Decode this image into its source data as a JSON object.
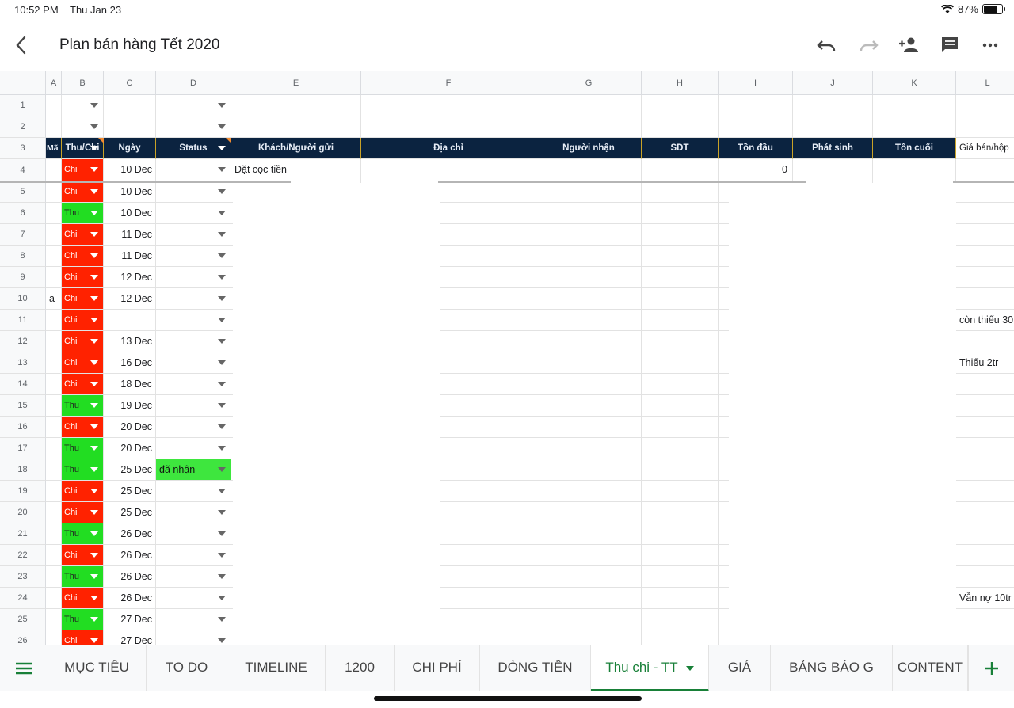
{
  "status_bar": {
    "time": "10:52 PM",
    "date": "Thu Jan 23",
    "battery": "87%",
    "battery_level": 0.87
  },
  "document": {
    "title": "Plan bán hàng Tết 2020"
  },
  "columns": [
    "A",
    "B",
    "C",
    "D",
    "E",
    "F",
    "G",
    "H",
    "I",
    "J",
    "K",
    "L"
  ],
  "header_row": {
    "row_number": "3",
    "a": "Mã",
    "b": "Thu/Chi",
    "c": "Ngày",
    "d": "Status",
    "e": "Khách/Người gửi",
    "f": "Địa chỉ",
    "g": "Người nhận",
    "h": "SDT",
    "i": "Tồn đầu",
    "j": "Phát sinh",
    "k": "Tồn cuối",
    "l": "Giá bán/hộp"
  },
  "rows": [
    {
      "n": "1",
      "a": "",
      "b": "",
      "c": "",
      "d": "",
      "e": "",
      "i": "",
      "l": ""
    },
    {
      "n": "2",
      "a": "",
      "b": "",
      "c": "",
      "d": "",
      "e": "",
      "i": "",
      "l": ""
    },
    {
      "n": "4",
      "a": "",
      "b": "Chi",
      "c": "10 Dec",
      "d": "",
      "e": "Đặt cọc tiền",
      "i": "0",
      "l": ""
    },
    {
      "n": "5",
      "a": "",
      "b": "Chi",
      "c": "10 Dec",
      "d": "",
      "e": "",
      "i": "",
      "l": ""
    },
    {
      "n": "6",
      "a": "",
      "b": "Thu",
      "c": "10 Dec",
      "d": "",
      "e": "",
      "i": "",
      "l": ""
    },
    {
      "n": "7",
      "a": "",
      "b": "Chi",
      "c": "11 Dec",
      "d": "",
      "e": "",
      "i": "",
      "l": ""
    },
    {
      "n": "8",
      "a": "",
      "b": "Chi",
      "c": "11 Dec",
      "d": "",
      "e": "",
      "i": "",
      "l": ""
    },
    {
      "n": "9",
      "a": "",
      "b": "Chi",
      "c": "12 Dec",
      "d": "",
      "e": "",
      "i": "",
      "l": ""
    },
    {
      "n": "10",
      "a": "a",
      "b": "Chi",
      "c": "12 Dec",
      "d": "",
      "e": "",
      "i": "",
      "l": ""
    },
    {
      "n": "11",
      "a": "",
      "b": "Chi",
      "c": "",
      "d": "",
      "e": "",
      "i": "",
      "l": "còn thiếu 30"
    },
    {
      "n": "12",
      "a": "",
      "b": "Chi",
      "c": "13 Dec",
      "d": "",
      "e": "",
      "i": "",
      "l": ""
    },
    {
      "n": "13",
      "a": "",
      "b": "Chi",
      "c": "16 Dec",
      "d": "",
      "e": "",
      "i": "",
      "l": "Thiếu 2tr"
    },
    {
      "n": "14",
      "a": "",
      "b": "Chi",
      "c": "18 Dec",
      "d": "",
      "e": "",
      "i": "",
      "l": ""
    },
    {
      "n": "15",
      "a": "",
      "b": "Thu",
      "c": "19 Dec",
      "d": "",
      "e": "",
      "i": "",
      "l": ""
    },
    {
      "n": "16",
      "a": "",
      "b": "Chi",
      "c": "20 Dec",
      "d": "",
      "e": "",
      "i": "",
      "l": ""
    },
    {
      "n": "17",
      "a": "",
      "b": "Thu",
      "c": "20 Dec",
      "d": "",
      "e": "",
      "i": "",
      "l": ""
    },
    {
      "n": "18",
      "a": "",
      "b": "Thu",
      "c": "25 Dec",
      "d": "đã nhận",
      "e": "",
      "i": "",
      "l": ""
    },
    {
      "n": "19",
      "a": "",
      "b": "Chi",
      "c": "25 Dec",
      "d": "",
      "e": "",
      "i": "",
      "l": ""
    },
    {
      "n": "20",
      "a": "",
      "b": "Chi",
      "c": "25 Dec",
      "d": "",
      "e": "",
      "i": "",
      "l": ""
    },
    {
      "n": "21",
      "a": "",
      "b": "Thu",
      "c": "26 Dec",
      "d": "",
      "e": "",
      "i": "",
      "l": ""
    },
    {
      "n": "22",
      "a": "",
      "b": "Chi",
      "c": "26 Dec",
      "d": "",
      "e": "",
      "i": "",
      "l": ""
    },
    {
      "n": "23",
      "a": "",
      "b": "Thu",
      "c": "26 Dec",
      "d": "",
      "e": "",
      "i": "",
      "l": ""
    },
    {
      "n": "24",
      "a": "",
      "b": "Chi",
      "c": "26 Dec",
      "d": "",
      "e": "",
      "i": "",
      "l": "Vẫn nợ 10tr"
    },
    {
      "n": "25",
      "a": "",
      "b": "Thu",
      "c": "27 Dec",
      "d": "",
      "e": "",
      "i": "",
      "l": ""
    },
    {
      "n": "26",
      "a": "",
      "b": "Chi",
      "c": "27 Dec",
      "d": "",
      "e": "",
      "i": "",
      "l": ""
    }
  ],
  "sheet_tabs": [
    "MỤC TIÊU",
    "TO DO",
    "TIMELINE",
    "1200",
    "CHI PHÍ",
    "DÒNG TIỀN",
    "Thu chi - TT",
    "GIÁ",
    "BẢNG BÁO G",
    "CONTENT"
  ],
  "active_tab": "Thu chi - TT",
  "colors": {
    "chi": "#ff2200",
    "thu": "#22dd22",
    "header_bg": "#0b2340",
    "active_tab": "#188038"
  }
}
